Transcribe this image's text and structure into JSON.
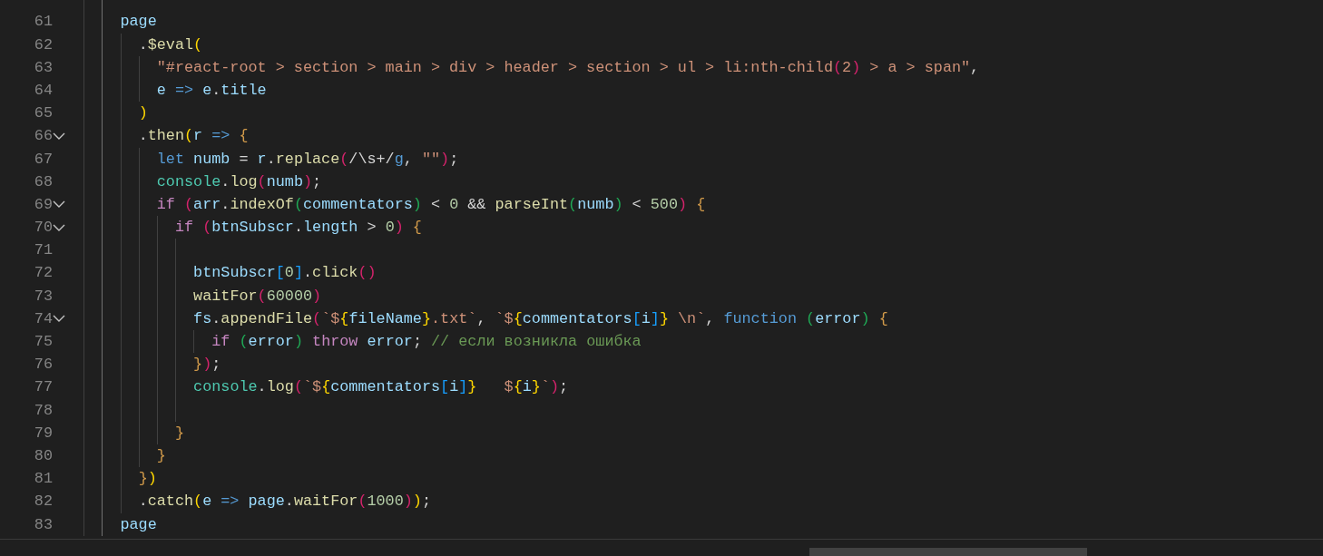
{
  "editor": {
    "lines": [
      {
        "foldable": false
      },
      {
        "number": "61",
        "foldable": false,
        "tokens": [
          {
            "text": "page",
            "kind": "variable"
          }
        ],
        "children": [
          {
            "number": "62",
            "foldable": false,
            "tokens": [
              {
                "text": ".",
                "kind": "plain"
              },
              {
                "text": "$eval",
                "kind": "function"
              },
              {
                "text": "(",
                "kind": "bracket1"
              }
            ],
            "children": [
              {
                "number": "63",
                "foldable": false,
                "tokens": [
                  {
                    "text": "\"#react-root > section > main > div > header > section > ul > li:nth-child",
                    "kind": "string"
                  },
                  {
                    "text": "(",
                    "kind": "bracket2"
                  },
                  {
                    "text": "2",
                    "kind": "string"
                  },
                  {
                    "text": ")",
                    "kind": "bracket2"
                  },
                  {
                    "text": " > a > span\"",
                    "kind": "string"
                  },
                  {
                    "text": ",",
                    "kind": "plain"
                  }
                ]
              },
              {
                "number": "64",
                "foldable": false,
                "tokens": [
                  {
                    "text": "e",
                    "kind": "variable"
                  },
                  {
                    "text": " =>",
                    "kind": "keyword"
                  },
                  {
                    "text": " e",
                    "kind": "variable"
                  },
                  {
                    "text": ".",
                    "kind": "plain"
                  },
                  {
                    "text": "title",
                    "kind": "variable"
                  }
                ]
              }
            ]
          },
          {
            "number": "65",
            "foldable": false,
            "tokens": [
              {
                "text": ")",
                "kind": "bracket1"
              }
            ]
          },
          {
            "number": "66",
            "foldable": true,
            "tokens": [
              {
                "text": ".",
                "kind": "plain"
              },
              {
                "text": "then",
                "kind": "function"
              },
              {
                "text": "(",
                "kind": "bracket1"
              },
              {
                "text": "r",
                "kind": "variable"
              },
              {
                "text": " =>",
                "kind": "keyword"
              },
              {
                "text": " {",
                "kind": "brace"
              }
            ],
            "children": [
              {
                "number": "67",
                "foldable": false,
                "tokens": [
                  {
                    "text": "let",
                    "kind": "keyword"
                  },
                  {
                    "text": " numb",
                    "kind": "variable"
                  },
                  {
                    "text": " = ",
                    "kind": "plain"
                  },
                  {
                    "text": "r",
                    "kind": "variable"
                  },
                  {
                    "text": ".",
                    "kind": "plain"
                  },
                  {
                    "text": "replace",
                    "kind": "function"
                  },
                  {
                    "text": "(",
                    "kind": "bracket2"
                  },
                  {
                    "text": "/\\s+/",
                    "kind": "plain"
                  },
                  {
                    "text": "g",
                    "kind": "keyword"
                  },
                  {
                    "text": ", ",
                    "kind": "plain"
                  },
                  {
                    "text": "\"\"",
                    "kind": "string"
                  },
                  {
                    "text": ")",
                    "kind": "bracket2"
                  },
                  {
                    "text": ";",
                    "kind": "plain"
                  }
                ]
              },
              {
                "number": "68",
                "foldable": false,
                "tokens": [
                  {
                    "text": "console",
                    "kind": "type"
                  },
                  {
                    "text": ".",
                    "kind": "plain"
                  },
                  {
                    "text": "log",
                    "kind": "function"
                  },
                  {
                    "text": "(",
                    "kind": "bracket2"
                  },
                  {
                    "text": "numb",
                    "kind": "variable"
                  },
                  {
                    "text": ")",
                    "kind": "bracket2"
                  },
                  {
                    "text": ";",
                    "kind": "plain"
                  }
                ]
              },
              {
                "number": "69",
                "foldable": true,
                "tokens": [
                  {
                    "text": "if",
                    "kind": "control"
                  },
                  {
                    "text": " (",
                    "kind": "bracket2"
                  },
                  {
                    "text": "arr",
                    "kind": "variable"
                  },
                  {
                    "text": ".",
                    "kind": "plain"
                  },
                  {
                    "text": "indexOf",
                    "kind": "function"
                  },
                  {
                    "text": "(",
                    "kind": "bracket3"
                  },
                  {
                    "text": "commentators",
                    "kind": "variable"
                  },
                  {
                    "text": ")",
                    "kind": "bracket3"
                  },
                  {
                    "text": " < ",
                    "kind": "plain"
                  },
                  {
                    "text": "0",
                    "kind": "number"
                  },
                  {
                    "text": " && ",
                    "kind": "plain"
                  },
                  {
                    "text": "parseInt",
                    "kind": "function"
                  },
                  {
                    "text": "(",
                    "kind": "bracket3"
                  },
                  {
                    "text": "numb",
                    "kind": "variable"
                  },
                  {
                    "text": ")",
                    "kind": "bracket3"
                  },
                  {
                    "text": " < ",
                    "kind": "plain"
                  },
                  {
                    "text": "500",
                    "kind": "number"
                  },
                  {
                    "text": ")",
                    "kind": "bracket2"
                  },
                  {
                    "text": " {",
                    "kind": "brace"
                  }
                ],
                "children": [
                  {
                    "number": "70",
                    "foldable": true,
                    "tokens": [
                      {
                        "text": "if",
                        "kind": "control"
                      },
                      {
                        "text": " (",
                        "kind": "bracket2"
                      },
                      {
                        "text": "btnSubscr",
                        "kind": "variable"
                      },
                      {
                        "text": ".",
                        "kind": "plain"
                      },
                      {
                        "text": "length",
                        "kind": "variable"
                      },
                      {
                        "text": " > ",
                        "kind": "plain"
                      },
                      {
                        "text": "0",
                        "kind": "number"
                      },
                      {
                        "text": ")",
                        "kind": "bracket2"
                      },
                      {
                        "text": " {",
                        "kind": "brace"
                      }
                    ],
                    "children": [
                      {
                        "number": "71",
                        "foldable": false
                      },
                      {
                        "number": "72",
                        "foldable": false,
                        "tokens": [
                          {
                            "text": "btnSubscr",
                            "kind": "variable"
                          },
                          {
                            "text": "[",
                            "kind": "bracket4"
                          },
                          {
                            "text": "0",
                            "kind": "number"
                          },
                          {
                            "text": "]",
                            "kind": "bracket4"
                          },
                          {
                            "text": ".",
                            "kind": "plain"
                          },
                          {
                            "text": "click",
                            "kind": "function"
                          },
                          {
                            "text": "()",
                            "kind": "bracket2"
                          }
                        ]
                      },
                      {
                        "number": "73",
                        "foldable": false,
                        "tokens": [
                          {
                            "text": "waitFor",
                            "kind": "function"
                          },
                          {
                            "text": "(",
                            "kind": "bracket2"
                          },
                          {
                            "text": "60000",
                            "kind": "number"
                          },
                          {
                            "text": ")",
                            "kind": "bracket2"
                          }
                        ]
                      },
                      {
                        "number": "74",
                        "foldable": true,
                        "tokens": [
                          {
                            "text": "fs",
                            "kind": "variable"
                          },
                          {
                            "text": ".",
                            "kind": "plain"
                          },
                          {
                            "text": "appendFile",
                            "kind": "function"
                          },
                          {
                            "text": "(",
                            "kind": "bracket2"
                          },
                          {
                            "text": "`$",
                            "kind": "string"
                          },
                          {
                            "text": "{",
                            "kind": "bracket1"
                          },
                          {
                            "text": "fileName",
                            "kind": "variable"
                          },
                          {
                            "text": "}",
                            "kind": "bracket1"
                          },
                          {
                            "text": ".txt`",
                            "kind": "string"
                          },
                          {
                            "text": ", ",
                            "kind": "plain"
                          },
                          {
                            "text": "`$",
                            "kind": "string"
                          },
                          {
                            "text": "{",
                            "kind": "bracket1"
                          },
                          {
                            "text": "commentators",
                            "kind": "variable"
                          },
                          {
                            "text": "[",
                            "kind": "bracket4"
                          },
                          {
                            "text": "i",
                            "kind": "variable"
                          },
                          {
                            "text": "]",
                            "kind": "bracket4"
                          },
                          {
                            "text": "}",
                            "kind": "bracket1"
                          },
                          {
                            "text": " \\n`",
                            "kind": "string"
                          },
                          {
                            "text": ", ",
                            "kind": "plain"
                          },
                          {
                            "text": "function",
                            "kind": "keyword"
                          },
                          {
                            "text": " (",
                            "kind": "bracket3"
                          },
                          {
                            "text": "error",
                            "kind": "variable"
                          },
                          {
                            "text": ")",
                            "kind": "bracket3"
                          },
                          {
                            "text": " {",
                            "kind": "brace"
                          }
                        ],
                        "children": [
                          {
                            "number": "75",
                            "foldable": false,
                            "tokens": [
                              {
                                "text": "if",
                                "kind": "control"
                              },
                              {
                                "text": " (",
                                "kind": "bracket3"
                              },
                              {
                                "text": "error",
                                "kind": "variable"
                              },
                              {
                                "text": ")",
                                "kind": "bracket3"
                              },
                              {
                                "text": " throw",
                                "kind": "control"
                              },
                              {
                                "text": " error",
                                "kind": "variable"
                              },
                              {
                                "text": "; ",
                                "kind": "plain"
                              },
                              {
                                "text": "// если возникла ошибка",
                                "kind": "comment"
                              }
                            ]
                          }
                        ]
                      },
                      {
                        "number": "76",
                        "foldable": false,
                        "tokens": [
                          {
                            "text": "}",
                            "kind": "brace"
                          },
                          {
                            "text": ")",
                            "kind": "bracket2"
                          },
                          {
                            "text": ";",
                            "kind": "plain"
                          }
                        ]
                      },
                      {
                        "number": "77",
                        "foldable": false,
                        "tokens": [
                          {
                            "text": "console",
                            "kind": "type"
                          },
                          {
                            "text": ".",
                            "kind": "plain"
                          },
                          {
                            "text": "log",
                            "kind": "function"
                          },
                          {
                            "text": "(",
                            "kind": "bracket2"
                          },
                          {
                            "text": "`$",
                            "kind": "string"
                          },
                          {
                            "text": "{",
                            "kind": "bracket1"
                          },
                          {
                            "text": "commentators",
                            "kind": "variable"
                          },
                          {
                            "text": "[",
                            "kind": "bracket4"
                          },
                          {
                            "text": "i",
                            "kind": "variable"
                          },
                          {
                            "text": "]",
                            "kind": "bracket4"
                          },
                          {
                            "text": "}",
                            "kind": "bracket1"
                          },
                          {
                            "text": "   $",
                            "kind": "string"
                          },
                          {
                            "text": "{",
                            "kind": "bracket1"
                          },
                          {
                            "text": "i",
                            "kind": "variable"
                          },
                          {
                            "text": "}",
                            "kind": "bracket1"
                          },
                          {
                            "text": "`",
                            "kind": "string"
                          },
                          {
                            "text": ")",
                            "kind": "bracket2"
                          },
                          {
                            "text": ";",
                            "kind": "plain"
                          }
                        ]
                      },
                      {
                        "number": "78",
                        "foldable": false
                      }
                    ]
                  },
                  {
                    "number": "79",
                    "foldable": false,
                    "tokens": [
                      {
                        "text": "}",
                        "kind": "brace"
                      }
                    ]
                  }
                ]
              },
              {
                "number": "80",
                "foldable": false,
                "tokens": [
                  {
                    "text": "}",
                    "kind": "brace"
                  }
                ]
              }
            ]
          },
          {
            "number": "81",
            "foldable": false,
            "tokens": [
              {
                "text": "}",
                "kind": "brace"
              },
              {
                "text": ")",
                "kind": "bracket1"
              }
            ]
          },
          {
            "number": "82",
            "foldable": false,
            "tokens": [
              {
                "text": ".",
                "kind": "plain"
              },
              {
                "text": "catch",
                "kind": "function"
              },
              {
                "text": "(",
                "kind": "bracket1"
              },
              {
                "text": "e",
                "kind": "variable"
              },
              {
                "text": " =>",
                "kind": "keyword"
              },
              {
                "text": " page",
                "kind": "variable"
              },
              {
                "text": ".",
                "kind": "plain"
              },
              {
                "text": "waitFor",
                "kind": "function"
              },
              {
                "text": "(",
                "kind": "bracket2"
              },
              {
                "text": "1000",
                "kind": "number"
              },
              {
                "text": ")",
                "kind": "bracket2"
              },
              {
                "text": ")",
                "kind": "bracket1"
              },
              {
                "text": ";",
                "kind": "plain"
              }
            ]
          }
        ]
      },
      {
        "number": "83",
        "foldable": false,
        "tokens": [
          {
            "text": "page",
            "kind": "variable"
          }
        ]
      }
    ]
  }
}
